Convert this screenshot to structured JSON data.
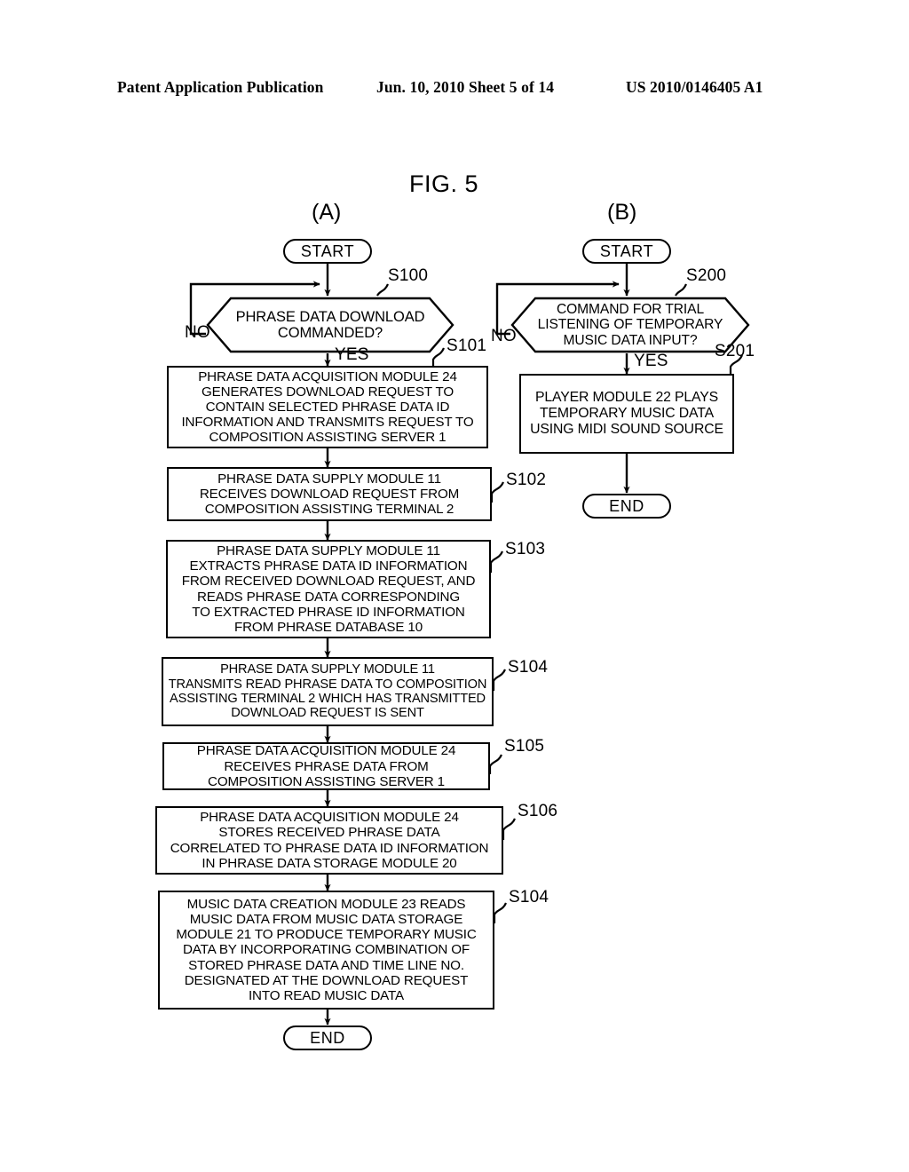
{
  "header": {
    "left": "Patent Application Publication",
    "middle": "Jun. 10, 2010  Sheet 5 of 14",
    "right": "US 2010/0146405 A1"
  },
  "figure": {
    "title": "FIG. 5",
    "panel_a_caption": "(A)",
    "panel_b_caption": "(B)"
  },
  "panel_a": {
    "start": "START",
    "end": "END",
    "decision": {
      "text": "PHRASE DATA DOWNLOAD\nCOMMANDED?",
      "step": "S100",
      "yes_label": "YES",
      "no_label": "NO"
    },
    "steps": [
      {
        "step": "S101",
        "text": "PHRASE DATA ACQUISITION MODULE 24\nGENERATES DOWNLOAD REQUEST TO\nCONTAIN SELECTED PHRASE DATA ID\nINFORMATION AND TRANSMITS REQUEST TO\nCOMPOSITION ASSISTING SERVER 1"
      },
      {
        "step": "S102",
        "text": "PHRASE DATA SUPPLY MODULE 11\nRECEIVES DOWNLOAD REQUEST FROM\nCOMPOSITION ASSISTING TERMINAL 2"
      },
      {
        "step": "S103",
        "text": "PHRASE DATA SUPPLY MODULE 11\nEXTRACTS PHRASE DATA ID INFORMATION\nFROM RECEIVED DOWNLOAD REQUEST, AND\nREADS PHRASE DATA CORRESPONDING\nTO EXTRACTED PHRASE ID INFORMATION\nFROM PHRASE DATABASE 10"
      },
      {
        "step": "S104",
        "text": "PHRASE DATA SUPPLY MODULE 11\nTRANSMITS READ PHRASE DATA TO COMPOSITION\nASSISTING TERMINAL 2 WHICH HAS TRANSMITTED\nDOWNLOAD REQUEST IS SENT"
      },
      {
        "step": "S105",
        "text": "PHRASE DATA ACQUISITION MODULE 24\nRECEIVES PHRASE DATA FROM\nCOMPOSITION ASSISTING SERVER 1"
      },
      {
        "step": "S106",
        "text": "PHRASE DATA ACQUISITION MODULE 24\nSTORES RECEIVED PHRASE DATA\nCORRELATED TO PHRASE DATA ID INFORMATION\nIN PHRASE DATA STORAGE MODULE 20"
      },
      {
        "step": "S104",
        "text": "MUSIC DATA CREATION MODULE 23 READS\nMUSIC DATA FROM MUSIC DATA STORAGE\nMODULE 21 TO PRODUCE TEMPORARY MUSIC\nDATA BY INCORPORATING COMBINATION OF\nSTORED PHRASE DATA AND TIME LINE NO.\nDESIGNATED AT THE DOWNLOAD REQUEST\nINTO READ MUSIC DATA"
      }
    ]
  },
  "panel_b": {
    "start": "START",
    "end": "END",
    "decision": {
      "text": "COMMAND FOR TRIAL\nLISTENING OF TEMPORARY\nMUSIC DATA INPUT?",
      "step": "S200",
      "yes_label": "YES",
      "no_label": "NO"
    },
    "steps": [
      {
        "step": "S201",
        "text": "PLAYER MODULE 22 PLAYS\nTEMPORARY MUSIC DATA\nUSING MIDI SOUND SOURCE"
      }
    ]
  },
  "colors": {
    "ink": "#000000",
    "paper": "#ffffff"
  }
}
